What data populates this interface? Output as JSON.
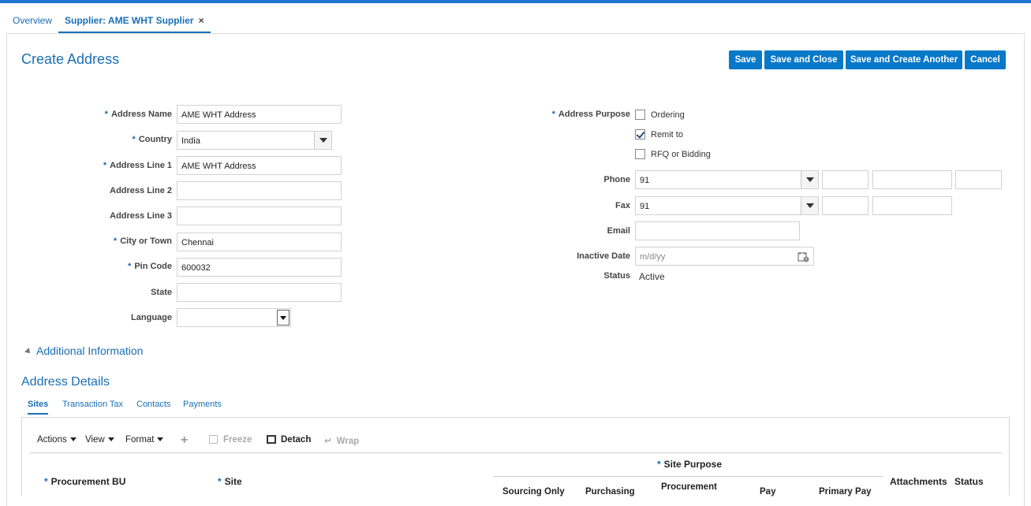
{
  "tabs": [
    {
      "label": "Overview"
    },
    {
      "label": "Supplier: AME WHT Supplier",
      "close": "×"
    }
  ],
  "page": {
    "title": "Create Address"
  },
  "buttons": {
    "save": "Save",
    "save_and_close": "Save and Close",
    "save_and_create_another": "Save and Create Another",
    "cancel": "Cancel"
  },
  "form": {
    "address_name": {
      "label": "Address Name",
      "value": "AME WHT Address"
    },
    "country": {
      "label": "Country",
      "value": "India"
    },
    "address_line_1": {
      "label": "Address Line 1",
      "value": "AME WHT Address"
    },
    "address_line_2": {
      "label": "Address Line 2",
      "value": ""
    },
    "address_line_3": {
      "label": "Address Line 3",
      "value": ""
    },
    "city": {
      "label": "City or Town",
      "value": "Chennai"
    },
    "pin_code": {
      "label": "Pin Code",
      "value": "600032"
    },
    "state": {
      "label": "State",
      "value": ""
    },
    "language": {
      "label": "Language",
      "value": ""
    },
    "address_purpose": {
      "label": "Address Purpose",
      "options": [
        {
          "label": "Ordering",
          "checked": false
        },
        {
          "label": "Remit to",
          "checked": true
        },
        {
          "label": "RFQ or Bidding",
          "checked": false
        }
      ]
    },
    "phone": {
      "label": "Phone",
      "value": "91"
    },
    "fax": {
      "label": "Fax",
      "value": "91"
    },
    "email": {
      "label": "Email",
      "value": ""
    },
    "inactive_date": {
      "label": "Inactive Date",
      "placeholder": "m/d/yy"
    },
    "status": {
      "label": "Status",
      "value": "Active"
    }
  },
  "additional_info": {
    "label": "Additional Information"
  },
  "details": {
    "title": "Address Details",
    "subtabs": [
      "Sites",
      "Transaction Tax",
      "Contacts",
      "Payments"
    ],
    "toolbar": {
      "actions": "Actions",
      "view": "View",
      "format": "Format",
      "freeze": "Freeze",
      "detach": "Detach",
      "wrap": "Wrap"
    },
    "columns": {
      "procurement_bu": "Procurement BU",
      "site": "Site",
      "site_purpose": "Site Purpose",
      "sourcing_only": "Sourcing Only",
      "purchasing": "Purchasing",
      "procurement": "Procurement",
      "pay": "Pay",
      "primary_pay": "Primary Pay",
      "attachments": "Attachments",
      "status": "Status"
    }
  },
  "colors": {
    "accent": "#1a6fb6",
    "button": "#0878c8",
    "topbar": "#1f74d2"
  }
}
